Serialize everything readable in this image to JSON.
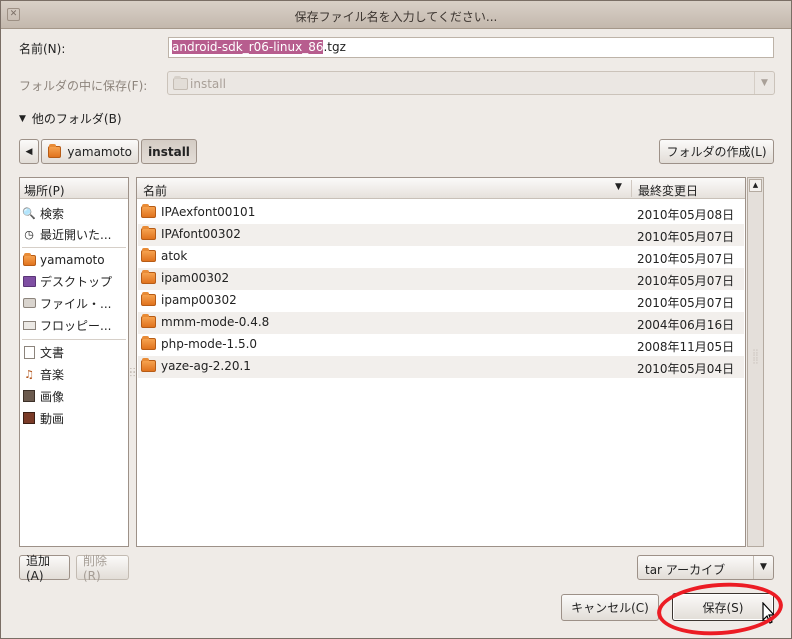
{
  "window": {
    "title": "保存ファイル名を入力してください..."
  },
  "form": {
    "name_label": "名前(N):",
    "name_value_selected": "android-sdk_r06-linux_86",
    "name_value_rest": ".tgz",
    "save_in_label": "フォルダの中に保存(F):",
    "save_in_value": "install",
    "browse_label": "他のフォルダ(B)"
  },
  "pathbar": {
    "items": [
      "yamamoto",
      "install"
    ],
    "create_folder_label": "フォルダの作成(L)"
  },
  "places": {
    "header": "場所(P)",
    "items": [
      {
        "label": "検索",
        "icon": "search-icon"
      },
      {
        "label": "最近開いた...",
        "icon": "recent-icon"
      },
      {
        "label": "yamamoto",
        "icon": "home-folder-icon"
      },
      {
        "label": "デスクトップ",
        "icon": "desktop-icon"
      },
      {
        "label": "ファイル・...",
        "icon": "filesystem-icon"
      },
      {
        "label": "フロッピー...",
        "icon": "floppy-icon"
      },
      {
        "label": "文書",
        "icon": "documents-icon"
      },
      {
        "label": "音楽",
        "icon": "music-icon"
      },
      {
        "label": "画像",
        "icon": "pictures-icon"
      },
      {
        "label": "動画",
        "icon": "videos-icon"
      }
    ],
    "add_label": "追加(A)",
    "remove_label": "削除(R)"
  },
  "files": {
    "col_name": "名前",
    "col_modified": "最終変更日",
    "rows": [
      {
        "name": "IPAexfont00101",
        "date": "2010年05月08日"
      },
      {
        "name": "IPAfont00302",
        "date": "2010年05月07日"
      },
      {
        "name": "atok",
        "date": "2010年05月07日"
      },
      {
        "name": "ipam00302",
        "date": "2010年05月07日"
      },
      {
        "name": "ipamp00302",
        "date": "2010年05月07日"
      },
      {
        "name": "mmm-mode-0.4.8",
        "date": "2004年06月16日"
      },
      {
        "name": "php-mode-1.5.0",
        "date": "2008年11月05日"
      },
      {
        "name": "yaze-ag-2.20.1",
        "date": "2010年05月04日"
      }
    ]
  },
  "filter": {
    "value": "tar アーカイブ"
  },
  "actions": {
    "cancel_label": "キャンセル(C)",
    "save_label": "保存(S)"
  },
  "colors": {
    "selection": "#b75d8e",
    "annotation_circle": "#ec1c24",
    "folder": "#f08a2f"
  }
}
